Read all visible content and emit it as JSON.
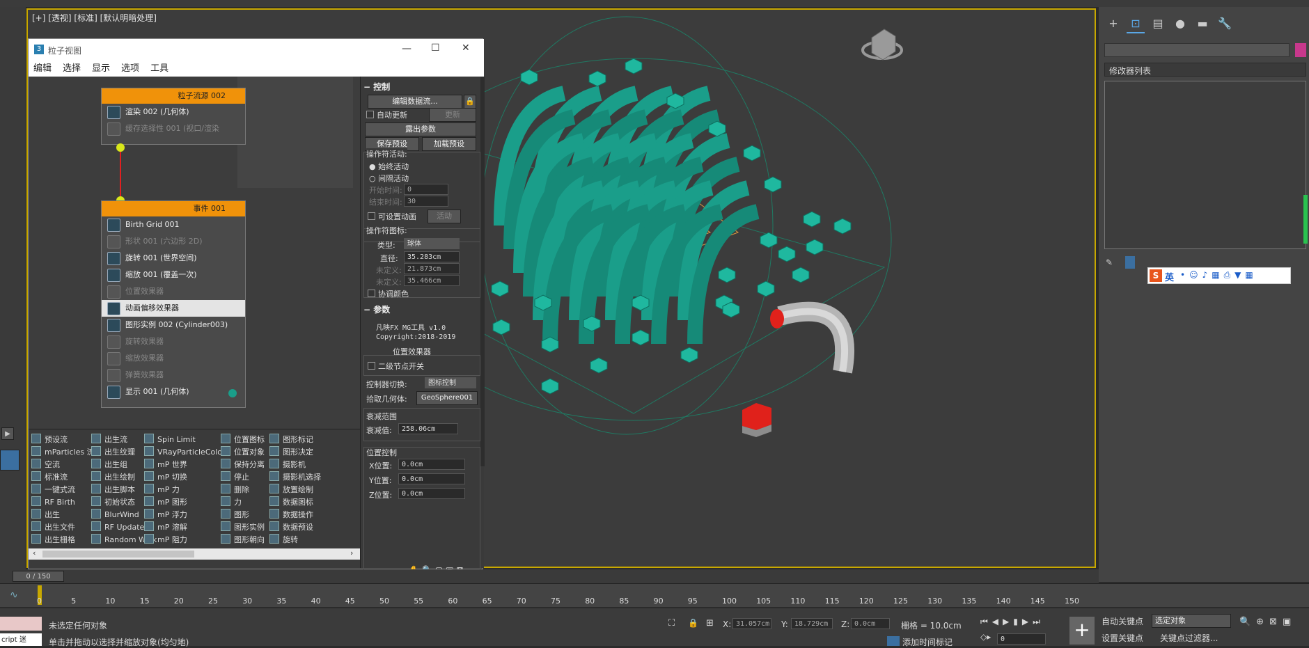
{
  "viewport": {
    "label": "[+] [透视] [标准] [默认明暗处理]"
  },
  "particle_view": {
    "title": "粒子视图",
    "menu": [
      "编辑",
      "选择",
      "显示",
      "选项",
      "工具"
    ],
    "window_buttons": {
      "minimize": "—",
      "maximize": "☐",
      "close": "✕"
    },
    "source_node": {
      "title": "粒子流源 002",
      "rows": [
        {
          "label": "渲染 002 (几何体)",
          "dim": false
        },
        {
          "label": "缓存选择性 001 (视口/渲染",
          "dim": true
        }
      ]
    },
    "event_node": {
      "title": "事件 001",
      "rows": [
        {
          "label": "Birth Grid 001",
          "dim": false,
          "hl": false
        },
        {
          "label": "形状 001 (六边形 2D)",
          "dim": true,
          "hl": false
        },
        {
          "label": "旋转 001 (世界空间)",
          "dim": false,
          "hl": false
        },
        {
          "label": "缩放 001 (覆盖一次)",
          "dim": false,
          "hl": false
        },
        {
          "label": "位置效果器",
          "dim": true,
          "hl": false
        },
        {
          "label": "动画偏移效果器",
          "dim": false,
          "hl": true
        },
        {
          "label": "图形实例 002 (Cylinder003)",
          "dim": false,
          "hl": false
        },
        {
          "label": "旋转效果器",
          "dim": true,
          "hl": false
        },
        {
          "label": "缩放效果器",
          "dim": true,
          "hl": false
        },
        {
          "label": "弹簧效果器",
          "dim": true,
          "hl": false
        },
        {
          "label": "显示 001 (几何体)",
          "dim": false,
          "hl": false
        }
      ]
    },
    "depot": [
      [
        "预设流",
        "mParticles 流",
        "空流",
        "标准流",
        "一键式流",
        "RF Birth",
        "出生",
        "出生文件",
        "出生栅格"
      ],
      [
        "出生流",
        "出生纹理",
        "出生组",
        "出生绘制",
        "出生脚本",
        "初始状态",
        "BlurWind",
        "RF Update",
        "Random Walk"
      ],
      [
        "Spin Limit",
        "VRayParticleColor",
        "mP 世界",
        "mP 切换",
        "mP 力",
        "mP 图形",
        "mP 浮力",
        "mP 溶解",
        "mP 阻力"
      ],
      [
        "位置图标",
        "位置对象",
        "保持分离",
        "停止",
        "删除",
        "力",
        "图形",
        "图形实例",
        "图形朝向"
      ],
      [
        "图形标记",
        "图形决定",
        "摄影机",
        "摄影机选择",
        "放置绘制",
        "数据图标",
        "数据操作",
        "数据预设",
        "旋转"
      ]
    ],
    "params": {
      "control_title": "控制",
      "edit_data_flow": "编辑数据流...",
      "auto_update": "自动更新",
      "update": "更新",
      "expose_params": "露出参数",
      "save_preset": "保存预设",
      "load_preset": "加载预设",
      "operator_active": "操作符活动:",
      "always_active": "始终活动",
      "interval_active": "间隔活动",
      "start_time": "开始时间:",
      "start_time_value": "0",
      "end_time": "结束时间:",
      "end_time_value": "30",
      "animatable": "可设置动画",
      "active_btn": "活动",
      "operator_icon": "操作符图标:",
      "type_label": "类型:",
      "type_value": "球体",
      "diameter_label": "直径:",
      "diameter_value": "35.283cm",
      "undef1_label": "未定义:",
      "undef1_value": "21.873cm",
      "undef2_label": "未定义:",
      "undef2_value": "35.466cm",
      "coord_color": "协调颜色",
      "params_title": "参数",
      "plugin_name": "凡映FX  MG工具 v1.0",
      "copyright": "Copyright:2018-2019",
      "effector_name": "位置效果器",
      "secondary_switch": "二级节点开关",
      "controller_switch": "控制器切换:",
      "controller_value": "图标控制",
      "pick_geometry": "拾取几何体:",
      "pick_value": "GeoSphere001",
      "falloff_range": "衰减范围",
      "falloff_value_label": "衰减值:",
      "falloff_value": "258.06cm",
      "position_control": "位置控制",
      "x_pos_label": "X位置:",
      "x_pos_value": "0.0cm",
      "y_pos_label": "Y位置:",
      "y_pos_value": "0.0cm",
      "z_pos_label": "Z位置:",
      "z_pos_value": "0.0cm"
    }
  },
  "command_panel": {
    "modifier_list": "修改器列表",
    "tabs": [
      "+",
      "⊡",
      "▤",
      "●",
      "▬",
      "🔧"
    ],
    "ime": {
      "lang": "英"
    }
  },
  "timeline": {
    "ticks": [
      "0",
      "5",
      "10",
      "15",
      "20",
      "25",
      "30",
      "35",
      "40",
      "45",
      "50",
      "55",
      "60",
      "65",
      "70",
      "75",
      "80",
      "85",
      "90",
      "95",
      "100",
      "105",
      "110",
      "115",
      "120",
      "125",
      "130",
      "135",
      "140",
      "145",
      "150"
    ],
    "slider_label": "0 / 150"
  },
  "status": {
    "script_label": "cript 迷",
    "no_selection": "未选定任何对象",
    "hint": "单击并拖动以选择并缩放对象(均匀地)",
    "x_label": "X:",
    "x_value": "31.057cm",
    "y_label": "Y:",
    "y_value": "18.729cm",
    "z_label": "Z:",
    "z_value": "0.0cm",
    "grid": "栅格 = 10.0cm",
    "add_time_tag": "添加时间标记",
    "auto_key": "自动关键点",
    "set_key": "设置关键点",
    "selected_object": "选定对象",
    "key_filters": "关键点过滤器...",
    "frame_value": "0"
  },
  "colors": {
    "accent": "#c8a800",
    "node_header": "#f0920a",
    "teal": "#1a9e8a",
    "red": "#e0211b"
  }
}
